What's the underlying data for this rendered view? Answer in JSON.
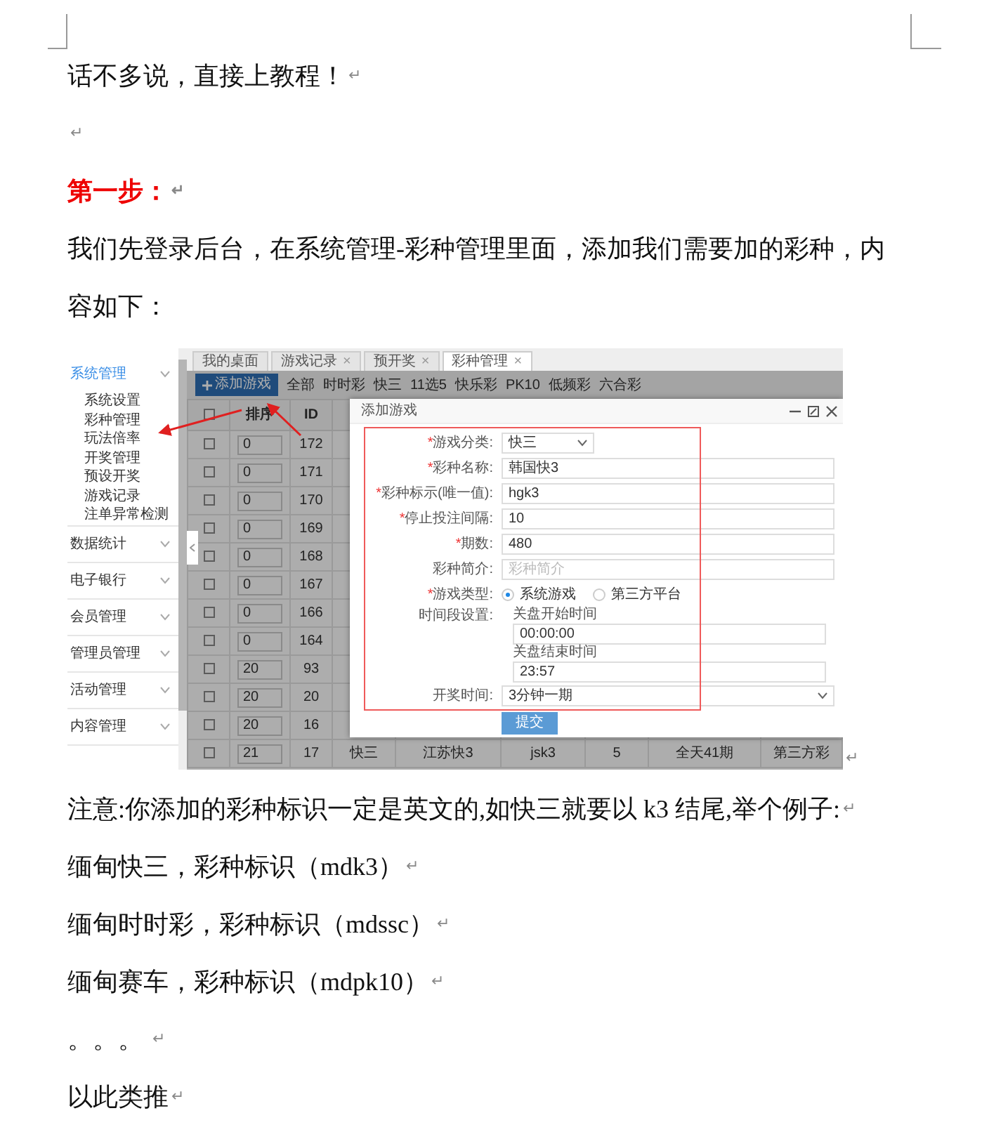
{
  "paragraphs": [
    {
      "kind": "text",
      "text": "话不多说，直接上教程！",
      "end_mark": "↵"
    },
    {
      "kind": "blank",
      "end_mark": "↵"
    },
    {
      "kind": "heading",
      "text": "第一步：",
      "end_mark": "↵"
    },
    {
      "kind": "text",
      "text": "我们先登录后台，在系统管理-彩种管理里面，添加我们需要加的彩种，内容如下："
    },
    {
      "kind": "screenshot",
      "end_mark": "↵"
    },
    {
      "kind": "text",
      "text": "注意:你添加的彩种标识一定是英文的,如快三就要以 k3 结尾,举个例子:",
      "end_mark": "↵"
    },
    {
      "kind": "text",
      "text": "缅甸快三，彩种标识（mdk3）",
      "end_mark": "↵"
    },
    {
      "kind": "text",
      "text": "缅甸时时彩，彩种标识（mdssc）",
      "end_mark": "↵"
    },
    {
      "kind": "text",
      "text": "缅甸赛车，彩种标识（mdpk10）",
      "end_mark": "↵"
    },
    {
      "kind": "text",
      "text": "。。。 ",
      "end_mark": "↵"
    },
    {
      "kind": "text",
      "text": "以此类推",
      "end_mark": "↵"
    }
  ],
  "screenshot": {
    "sidebar": [
      {
        "label": "系统管理",
        "expanded": true,
        "children": [
          "系统设置",
          "彩种管理",
          "玩法倍率",
          "开奖管理",
          "预设开奖",
          "游戏记录",
          "注单异常检测"
        ]
      },
      {
        "label": "数据统计",
        "expanded": false
      },
      {
        "label": "电子银行",
        "expanded": false
      },
      {
        "label": "会员管理",
        "expanded": false
      },
      {
        "label": "管理员管理",
        "expanded": false
      },
      {
        "label": "活动管理",
        "expanded": false
      },
      {
        "label": "内容管理",
        "expanded": false
      }
    ],
    "tabs": [
      {
        "label": "我的桌面",
        "selected": false
      },
      {
        "label": "游戏记录",
        "selected": false,
        "close_mark": "×"
      },
      {
        "label": "预开奖",
        "selected": false,
        "close_mark": "×"
      },
      {
        "label": "彩种管理",
        "selected": true,
        "close_mark": "×"
      }
    ],
    "add_button": "添加游戏",
    "filters": [
      "全部",
      "时时彩",
      "快三",
      "11选5",
      "快乐彩",
      "PK10",
      "低频彩",
      "六合彩"
    ],
    "table": {
      "header_checked": false,
      "columns": [
        "排序",
        "ID"
      ],
      "rows": [
        {
          "checked": false,
          "cells": [
            "0",
            "172"
          ]
        },
        {
          "checked": false,
          "cells": [
            "0",
            "171"
          ]
        },
        {
          "checked": false,
          "cells": [
            "0",
            "170"
          ]
        },
        {
          "checked": false,
          "cells": [
            "0",
            "169"
          ]
        },
        {
          "checked": false,
          "cells": [
            "0",
            "168"
          ]
        },
        {
          "checked": false,
          "cells": [
            "0",
            "167"
          ]
        },
        {
          "checked": false,
          "cells": [
            "0",
            "166"
          ]
        },
        {
          "checked": false,
          "cells": [
            "0",
            "164"
          ]
        },
        {
          "checked": false,
          "cells": [
            "20",
            "93"
          ]
        },
        {
          "checked": false,
          "cells": [
            "20",
            "20"
          ]
        },
        {
          "checked": false,
          "cells": [
            "20",
            "16"
          ]
        },
        {
          "checked": false,
          "cells": [
            "21",
            "17",
            "快三",
            "江苏快3",
            "jsk3",
            "5",
            "全天41期",
            "第三方彩"
          ]
        }
      ]
    },
    "dialog": {
      "title": "添加游戏",
      "fields": [
        {
          "kind": "select",
          "required_mark": "*",
          "label": "游戏分类:",
          "value": "快三"
        },
        {
          "kind": "input",
          "required_mark": "*",
          "label": "彩种名称:",
          "value": "韩国快3"
        },
        {
          "kind": "input",
          "required_mark": "*",
          "label": "彩种标示(唯一值):",
          "value": "hgk3"
        },
        {
          "kind": "input",
          "required_mark": "*",
          "label": "停止投注间隔:",
          "value": "10"
        },
        {
          "kind": "input",
          "required_mark": "*",
          "label": "期数:",
          "value": "480"
        },
        {
          "kind": "input",
          "label": "彩种简介:",
          "placeholder": "彩种简介"
        },
        {
          "kind": "radio",
          "required_mark": "*",
          "label": "游戏类型:",
          "options": [
            {
              "label": "系统游戏",
              "selected": true
            },
            {
              "label": "第三方平台",
              "selected": false
            }
          ]
        },
        {
          "kind": "timerange",
          "label": "时间段设置:",
          "parts": [
            {
              "caption": "关盘开始时间",
              "value": "00:00:00"
            },
            {
              "caption": "关盘结束时间",
              "value": "23:57"
            }
          ]
        },
        {
          "kind": "select",
          "label": "开奖时间:",
          "value": "3分钟一期"
        }
      ],
      "submit": "提交"
    }
  }
}
